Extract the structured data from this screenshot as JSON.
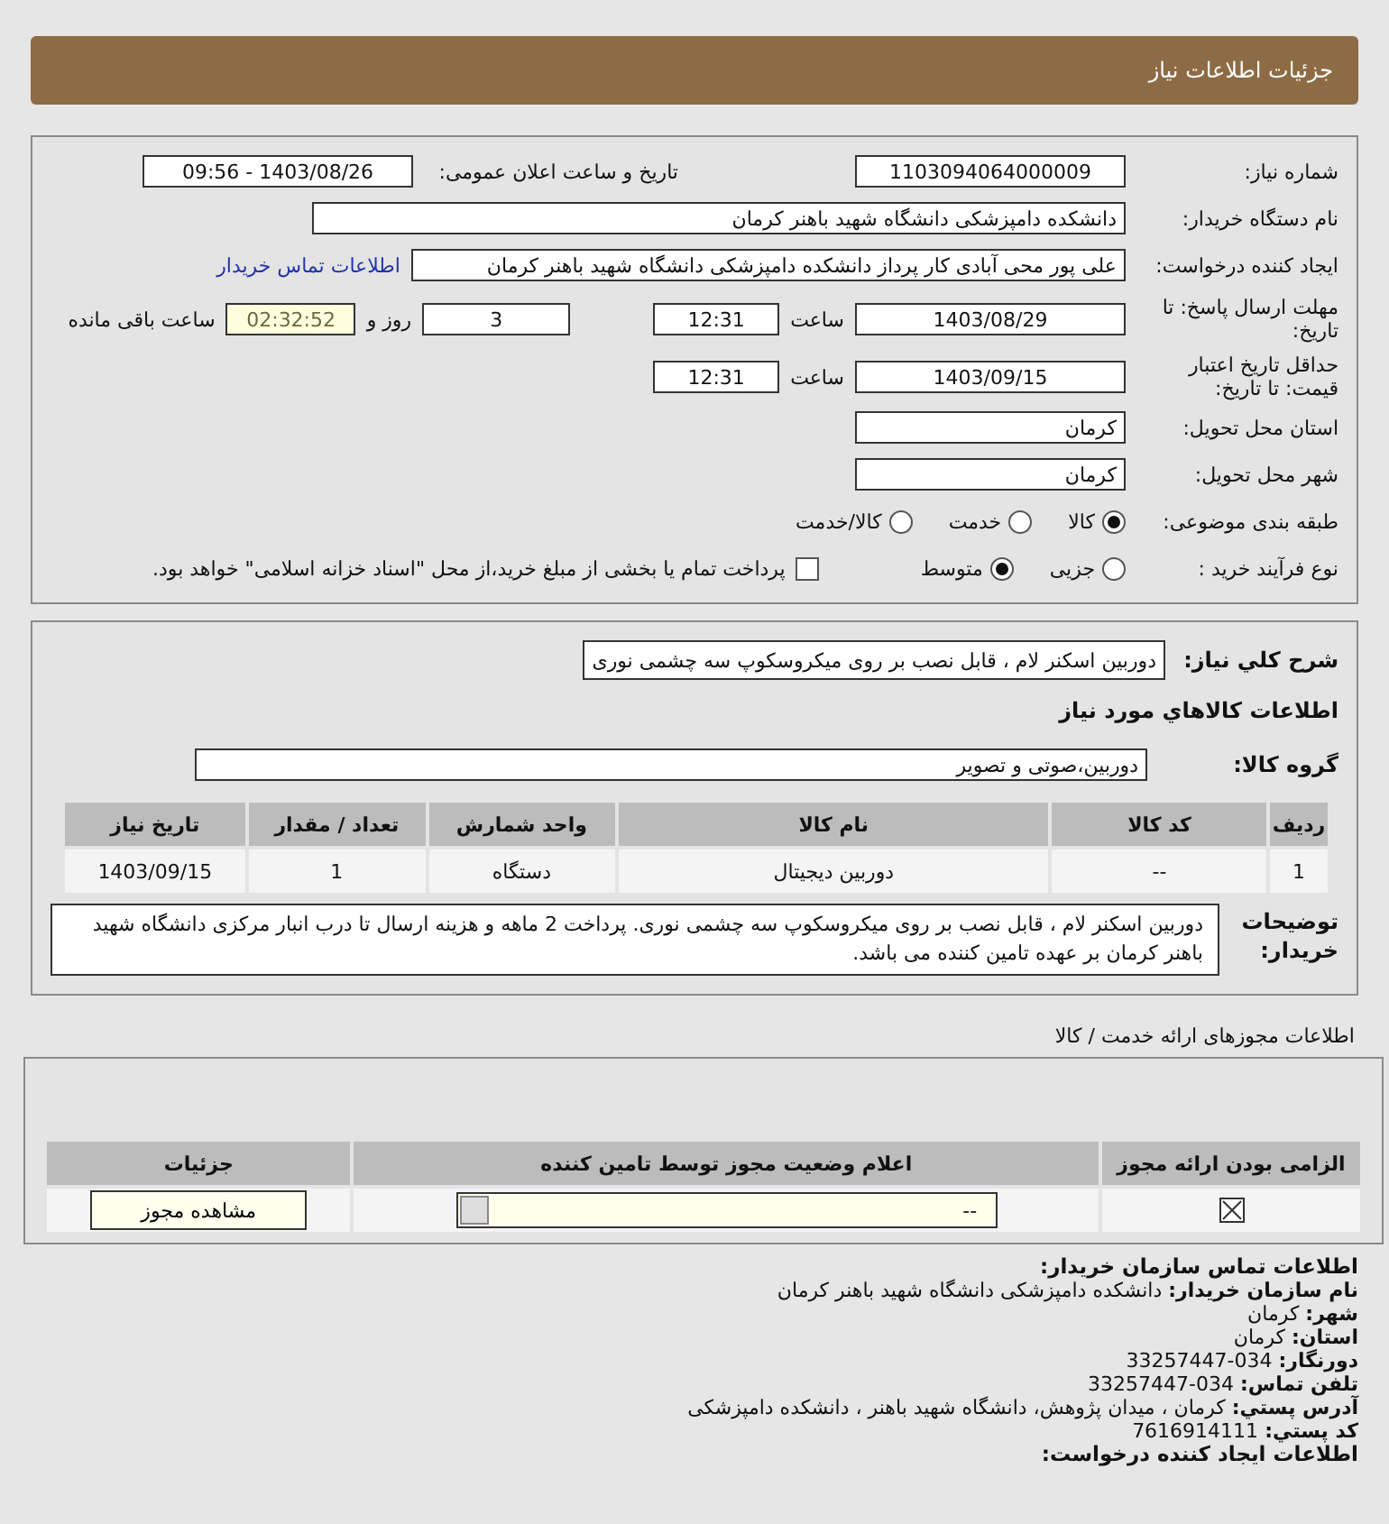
{
  "header": {
    "title": "جزئیات اطلاعات نیاز"
  },
  "need_number": {
    "label": "شماره نیاز:",
    "value": "1103094064000009"
  },
  "announce": {
    "label": "تاریخ و ساعت اعلان عمومی:",
    "value": "1403/08/26 - 09:56"
  },
  "buyer_org": {
    "label": "نام دستگاه خریدار:",
    "value": "دانشکده دامپزشکی دانشگاه شهید باهنر کرمان"
  },
  "requester": {
    "label": "ایجاد کننده درخواست:",
    "value": "علی پور محی آبادی کار پرداز دانشکده دامپزشکی دانشگاه شهید باهنر کرمان",
    "link": "اطلاعات تماس خریدار"
  },
  "reply_deadline": {
    "label": "مهلت ارسال پاسخ: تا تاریخ:",
    "date": "1403/08/29",
    "time_label": "ساعت",
    "time": "12:31",
    "days": "3",
    "days_label": "روز و",
    "remaining": "02:32:52",
    "remaining_label": "ساعت باقی مانده"
  },
  "price_validity": {
    "label": "حداقل تاریخ اعتبار قیمت: تا تاریخ:",
    "date": "1403/09/15",
    "time_label": "ساعت",
    "time": "12:31"
  },
  "province": {
    "label": "استان محل تحویل:",
    "value": "کرمان"
  },
  "city": {
    "label": "شهر محل تحویل:",
    "value": "کرمان"
  },
  "category": {
    "label": "طبقه بندی موضوعی:",
    "options": [
      {
        "label": "کالا",
        "selected": true
      },
      {
        "label": "خدمت",
        "selected": false
      },
      {
        "label": "کالا/خدمت",
        "selected": false
      }
    ]
  },
  "purchase_type": {
    "label": "نوع فرآیند خرید :",
    "options": [
      {
        "label": "جزیی",
        "selected": false
      },
      {
        "label": "متوسط",
        "selected": true
      }
    ],
    "prepay": {
      "label": "پرداخت تمام یا بخشی از مبلغ خرید،از محل \"اسناد خزانه اسلامی\" خواهد بود.",
      "checked": false
    }
  },
  "summary": {
    "label": "شرح کلي نياز:",
    "value": "دوربین اسکنر لام ، قابل نصب بر روی میکروسکوپ سه چشمی نوری"
  },
  "goods_heading": "اطلاعات کالاهاي مورد نياز",
  "goods_group": {
    "label": "گروه کالا:",
    "value": "دوربین،صوتی و تصویر"
  },
  "goods_table": {
    "columns": [
      "ردیف",
      "کد کالا",
      "نام کالا",
      "واحد شمارش",
      "تعداد / مقدار",
      "تاریخ نیاز"
    ],
    "rows": [
      {
        "cells": [
          "1",
          "--",
          "دوربین دیجیتال",
          "دستگاه",
          "1",
          "1403/09/15"
        ]
      }
    ]
  },
  "buyer_notes": {
    "label": "توضیحات خریدار:",
    "value": "دوربین اسکنر لام ، قابل نصب بر روی میکروسکوپ سه چشمی نوری. پرداخت 2 ماهه و هزینه ارسال تا درب انبار مرکزی دانشگاه شهید باهنر کرمان بر عهده تامین کننده می باشد."
  },
  "license_heading": "اطلاعات مجوزهای ارائه خدمت / کالا",
  "license_table": {
    "columns": [
      "الزامی بودن ارائه مجوز",
      "اعلام وضعیت مجوز توسط تامین کننده",
      "جزئیات"
    ],
    "rows": [
      {
        "required": true,
        "status": "--",
        "details_button": "مشاهده مجوز"
      }
    ]
  },
  "contact": {
    "title": "اطلاعات تماس سازمان خریدار:",
    "lines": [
      "**نام سازمان خریدار:** دانشکده دامپزشکی دانشگاه شهید باهنر کرمان",
      "**شهر:** کرمان",
      "**استان:** کرمان",
      "**دورنگار:** 034-33257447",
      "**تلفن تماس:** 034-33257447",
      "**آدرس پستي:** کرمان ، میدان پژوهش، دانشگاه شهید باهنر ، دانشکده دامپزشکی",
      "**کد پستي:** 7616914111"
    ],
    "footer_title": "اطلاعات ایجاد کننده درخواست:"
  }
}
